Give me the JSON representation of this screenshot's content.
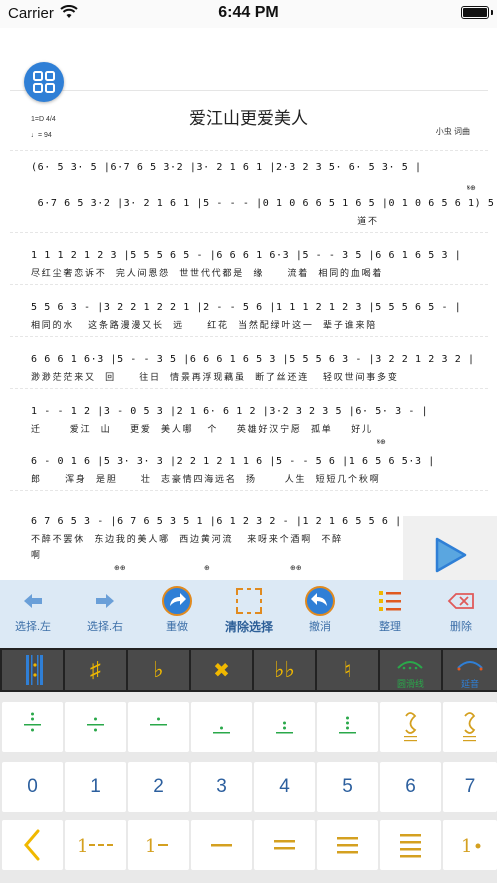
{
  "status": {
    "carrier": "Carrier",
    "time": "6:44 PM"
  },
  "score": {
    "title": "爱江山更爱美人",
    "key_signature": "1=D 4/4",
    "tempo": "♩= 94",
    "composer": "小虫 词曲",
    "rows": [
      {
        "notes": "(6· 5 3· 5 |6·7 6 5 3·2 |3· 2 1 6 1 |2·3 2 3 5· 6· 5 3· 5 |",
        "lyrics": ""
      },
      {
        "notes": " 6·7 6 5 3·2 |3· 2 1 6 1 |5 - - - |0 1 0 6 6 5 1 6 5 |0 1 0 6 5 6 1) 5 |6",
        "lyrics": "                                                                      道不"
      },
      {
        "notes": "1 1 1 2 1 2 3 |5 5 5 6 5 - |6 6 6 1 6·3 |5 - - 3 5 |6 6 1 6 5 3 |",
        "lyrics": "尽红尘奢恋诉不  完人间恩怨  世世代代都是  缘     流着  相同的血喝着"
      },
      {
        "notes": "5 5 6 3 - |3 2 2 1 2 2 1 |2 - - 5 6 |1 1 1 2 1 2 3 |5 5 5 6 5 - |",
        "lyrics": "相同的水   这条路漫漫又长  远     红花  当然配绿叶这一  辈子谁来陪"
      },
      {
        "notes": "6 6 6 1 6·3 |5 - - 3 5 |6 6 6 1 6 5 3 |5 5 5 6 3 - |3 2 2 1 2 3 2 |",
        "lyrics": "渺渺茫茫来又  回     往日  情景再浮现藕虽  断了丝还连   轻叹世间事多变"
      },
      {
        "notes": "1 - - 1 2 |3 - 0 5 3 |2 1 6· 6 1 2 |3·2 3 2 3 5 |6· 5· 3 - |",
        "lyrics": "迁      爱江  山    更爱  美人哪   个    英雄好汉宁愿  孤单    好儿"
      },
      {
        "notes": "6 - 0 1 6 |5 3· 3· 3 |2 2 1 2 1 1 6 |5 - - 5 6 |1 6 5 6 5·3 |",
        "lyrics": "郎     浑身  是胆     壮  志豪情四海远名  扬      人生  短短几个秋啊"
      },
      {
        "notes": "6 7 6 5 3 - |6 7 6 5 3 5 1 |6 1 2 3 2 - |1 2 1 6 5 5 6 |",
        "lyrics": "不醉不罢休  东边我的美人哪  西边黄河流   来呀来个酒啊  不醉"
      }
    ],
    "extra_lyric": "啊"
  },
  "play_panel": {
    "label": "播放"
  },
  "toolbar": {
    "select_left": "选择.左",
    "select_right": "选择.右",
    "redo": "重做",
    "clear_selection": "清除选择",
    "undo": "撤消",
    "arrange": "整理",
    "delete": "删除"
  },
  "accents": {
    "legato": "圆滑线",
    "extend": "延音"
  },
  "keypad": {
    "digits": [
      "0",
      "1",
      "2",
      "3",
      "4",
      "5",
      "6",
      "7"
    ]
  },
  "colors": {
    "accent_blue": "#2f7fd6",
    "gold": "#d4a020",
    "green": "#2aa84a",
    "toolbar_bg": "#dce9f5"
  }
}
